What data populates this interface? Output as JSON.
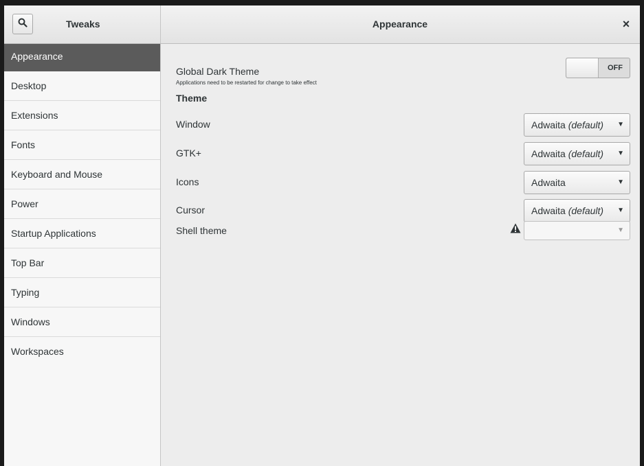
{
  "header": {
    "app_title": "Tweaks",
    "page_title": "Appearance",
    "close_glyph": "×"
  },
  "sidebar": {
    "items": [
      {
        "label": "Appearance",
        "selected": true
      },
      {
        "label": "Desktop"
      },
      {
        "label": "Extensions"
      },
      {
        "label": "Fonts"
      },
      {
        "label": "Keyboard and Mouse"
      },
      {
        "label": "Power"
      },
      {
        "label": "Startup Applications"
      },
      {
        "label": "Top Bar"
      },
      {
        "label": "Typing"
      },
      {
        "label": "Windows"
      },
      {
        "label": "Workspaces"
      }
    ]
  },
  "main": {
    "dark_theme": {
      "label": "Global Dark Theme",
      "note": "Applications need to be restarted for change to take effect",
      "state": "OFF"
    },
    "theme_section": "Theme",
    "rows": [
      {
        "label": "Window",
        "value": "Adwaita",
        "suffix": "(default)"
      },
      {
        "label": "GTK+",
        "value": "Adwaita",
        "suffix": "(default)"
      },
      {
        "label": "Icons",
        "value": "Adwaita",
        "suffix": ""
      },
      {
        "label": "Cursor",
        "value": "Adwaita",
        "suffix": "(default)"
      },
      {
        "label": "Shell theme",
        "value": "",
        "suffix": ""
      }
    ],
    "warning_icon": "warning-icon"
  },
  "colors": {
    "selected_bg": "#5b5b5b",
    "window_bg": "#ededed",
    "sidebar_bg": "#f7f7f7"
  }
}
